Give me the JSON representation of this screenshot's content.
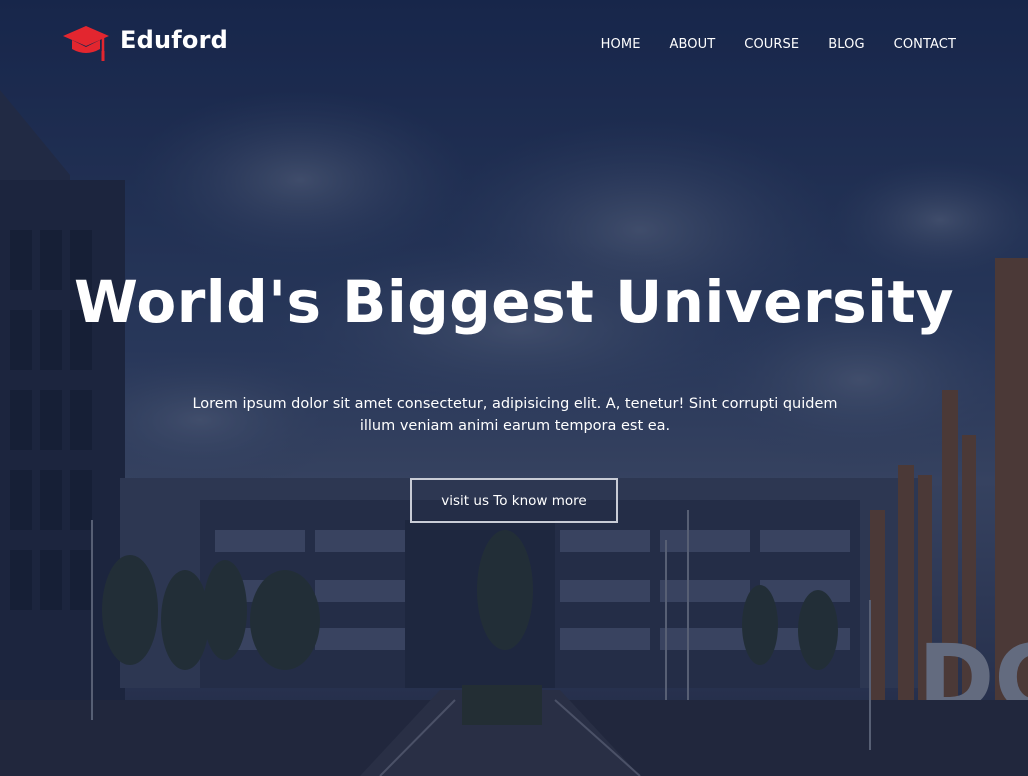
{
  "brand": {
    "name": "Eduford",
    "logo_icon": "graduation-cap-icon",
    "logo_color": "#e3262f"
  },
  "nav": {
    "items": [
      {
        "label": "HOME"
      },
      {
        "label": "ABOUT"
      },
      {
        "label": "COURSE"
      },
      {
        "label": "BLOG"
      },
      {
        "label": "CONTACT"
      }
    ]
  },
  "hero": {
    "title": "World's Biggest University",
    "text": "Lorem ipsum dolor sit amet consectetur, adipisicing elit. A, tenetur! Sint corrupti quidem illum veniam animi earum tempora est ea.",
    "button_label": "visit us To know more",
    "overlay_color": "#1a2550"
  }
}
